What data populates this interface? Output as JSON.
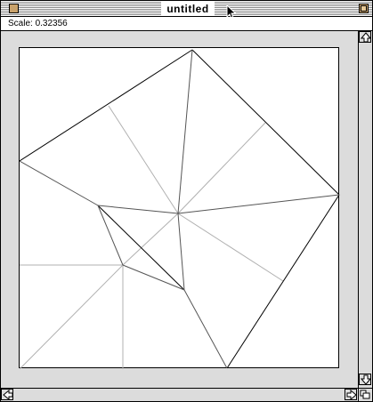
{
  "window": {
    "title": "untitled"
  },
  "status": {
    "scale_text": "Scale: 0.32356"
  },
  "icons": {
    "close": "close-box",
    "zoom": "zoom-box",
    "cursor": "arrow-cursor",
    "scroll_up": "arrow-up",
    "scroll_down": "arrow-down",
    "scroll_left": "arrow-left",
    "scroll_right": "arrow-right",
    "grow": "grow-box"
  },
  "colors": {
    "background": "#dcdcdc",
    "canvas": "#ffffff",
    "dark_line": "#000000",
    "light_line": "#b0b0b0"
  }
}
